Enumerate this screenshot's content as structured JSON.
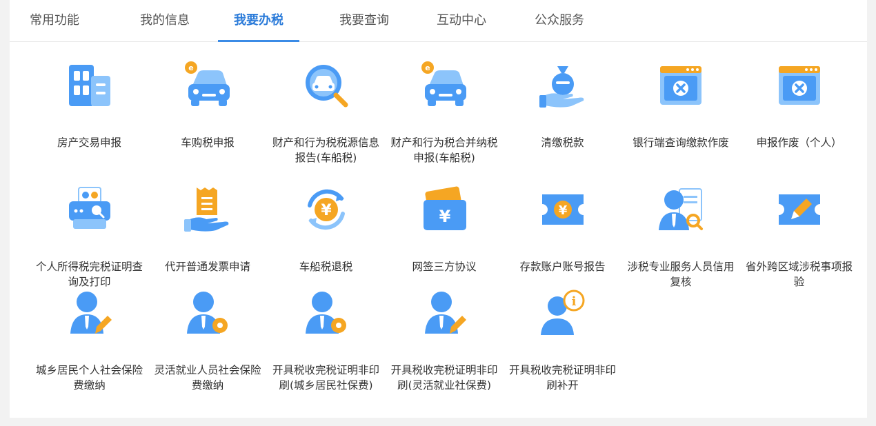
{
  "tabs": [
    "常用功能",
    "我的信息",
    "我要办税",
    "我要查询",
    "互动中心",
    "公众服务"
  ],
  "active_tab_index": 2,
  "colors": {
    "accent": "#2b7bd9",
    "icon_blue": "#4a9bf5",
    "icon_orange": "#f5a623"
  },
  "items": [
    {
      "label": "房产交易申报",
      "icon": "building-icon"
    },
    {
      "label": "车购税申报",
      "icon": "car-coin-icon"
    },
    {
      "label": "财产和行为税税源信息报告(车船税)",
      "icon": "car-search-icon"
    },
    {
      "label": "财产和行为税合并纳税申报(车船税)",
      "icon": "car-coin-icon"
    },
    {
      "label": "清缴税款",
      "icon": "money-bag-hand-icon"
    },
    {
      "label": "银行端查询缴款作废",
      "icon": "window-close-icon"
    },
    {
      "label": "申报作废（个人）",
      "icon": "window-close-icon"
    },
    {
      "label": "个人所得税完税证明查询及打印",
      "icon": "printer-icon"
    },
    {
      "label": "代开普通发票申请",
      "icon": "invoice-hand-icon"
    },
    {
      "label": "车船税退税",
      "icon": "yuan-refresh-icon"
    },
    {
      "label": "网签三方协议",
      "icon": "wallet-yuan-icon"
    },
    {
      "label": "存款账户账号报告",
      "icon": "ticket-yuan-icon"
    },
    {
      "label": "涉税专业服务人员信用复核",
      "icon": "person-doc-search-icon"
    },
    {
      "label": "省外跨区域涉税事项报验",
      "icon": "ticket-edit-icon"
    },
    {
      "label": "城乡居民个人社会保险费缴纳",
      "icon": "person-edit-icon"
    },
    {
      "label": "灵活就业人员社会保险费缴纳",
      "icon": "person-gear-icon"
    },
    {
      "label": "开具税收完税证明非印刷(城乡居民社保费)",
      "icon": "person-gear-icon"
    },
    {
      "label": "开具税收完税证明非印刷(灵活就业社保费)",
      "icon": "person-edit-icon"
    },
    {
      "label": "开具税收完税证明非印刷补开",
      "icon": "person-info-icon"
    }
  ]
}
